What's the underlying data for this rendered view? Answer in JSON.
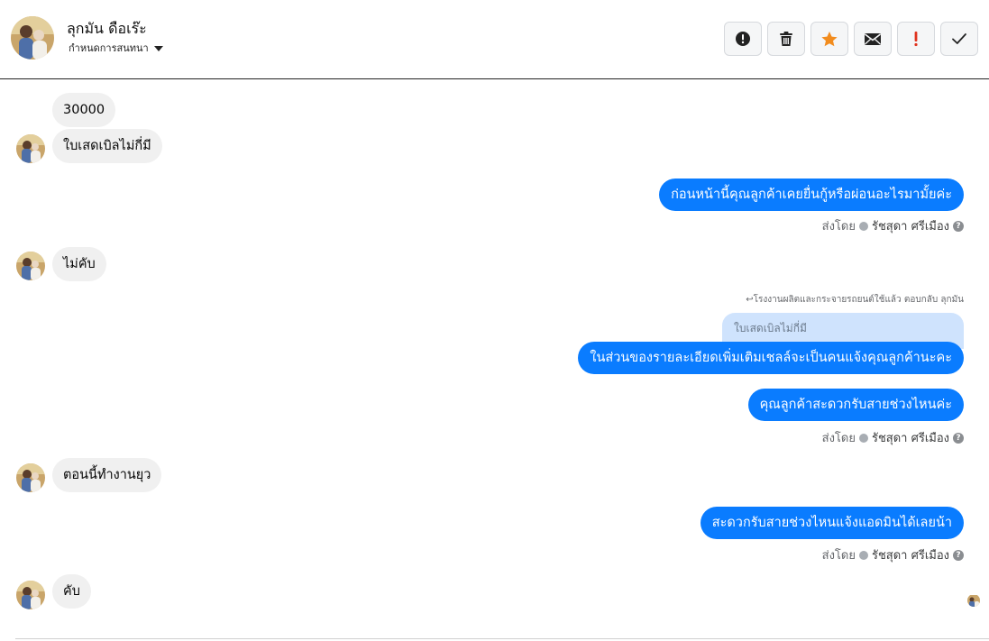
{
  "header": {
    "contact_name": "ลุกมัน ดือเร๊ะ",
    "assign_label": "กำหนดการสนทนา",
    "tools": [
      {
        "icon": "alert-circle-icon",
        "color": "#222222"
      },
      {
        "icon": "trash-icon",
        "color": "#222222"
      },
      {
        "icon": "star-icon",
        "color": "#f28c1e"
      },
      {
        "icon": "envelope-icon",
        "color": "#222222"
      },
      {
        "icon": "exclamation-icon",
        "color": "#e0321e"
      },
      {
        "icon": "checkmark-icon",
        "color": "#222222"
      }
    ]
  },
  "messages": {
    "m1": "30000",
    "m2": "ใบเสดเบิลไม่กี่มี",
    "m3": "ก่อนหน้านี้คุณลูกค้าเคยยื่นกู้หรือผ่อนอะไรมามั้ยค่ะ",
    "m4": "ไม่คับ",
    "m5": "ในส่วนของรายละเอียดเพิ่มเติมเชลล์จะเป็นคนแจ้งคุณลูกค้านะคะ",
    "m6": "คุณลูกค้าสะดวกรับสายช่วงไหนค่ะ",
    "m7": "ตอนนี้ทำงานยุว",
    "m8": "สะดวกรับสายช่วงไหนแจ้งแอดมินได้เลยน้า",
    "m9": "คับ"
  },
  "reply": {
    "note": "↩โรงงานผลิตและกระจายรถยนต์ใช้แล้ว ตอบกลับ ลุกมัน",
    "quoted_text": "ใบเสดเบิลไม่กี่มี"
  },
  "sent_by": {
    "label": "ส่งโดย",
    "agent": "รัชสุดา ศรีเมือง",
    "help": "?"
  },
  "colors": {
    "outgoing_bubble": "#0a7cff",
    "incoming_bubble": "#f0f0f0",
    "quoted_bubble": "#cfe3fd"
  }
}
